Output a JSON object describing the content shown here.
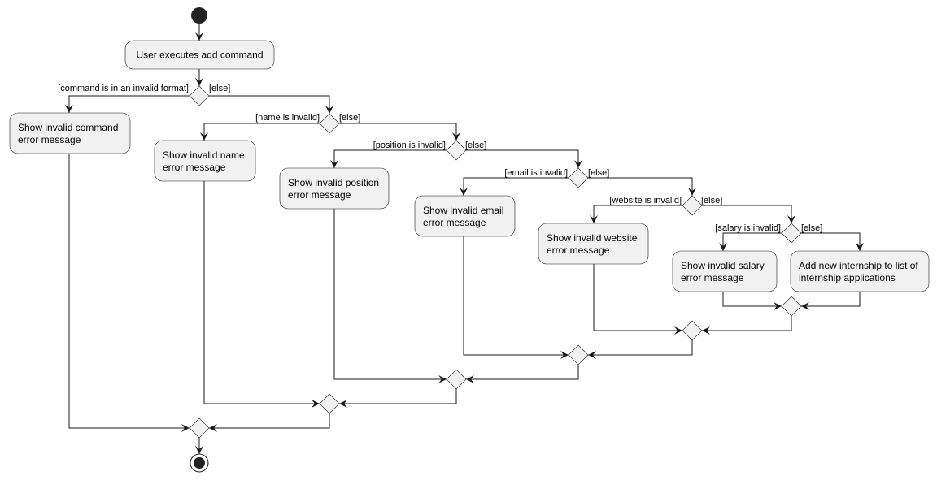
{
  "diagram": {
    "type": "activity",
    "colors": {
      "node_fill": "#f1f1f1",
      "line": "#181818",
      "start_end": "#222222"
    },
    "activities": {
      "start_cmd": [
        "User executes add command"
      ],
      "invalid_command": [
        "Show invalid command",
        "error message"
      ],
      "invalid_name": [
        "Show invalid name",
        "error message"
      ],
      "invalid_position": [
        "Show invalid position",
        "error message"
      ],
      "invalid_email": [
        "Show invalid email",
        "error message"
      ],
      "invalid_website": [
        "Show invalid website",
        "error message"
      ],
      "invalid_salary": [
        "Show invalid salary",
        "error message"
      ],
      "add_internship": [
        "Add new internship to list of",
        "internship applications"
      ]
    },
    "guards": {
      "d1_yes": "[command is in an invalid format]",
      "d1_no": "[else]",
      "d2_yes": "[name is invalid]",
      "d2_no": "[else]",
      "d3_yes": "[position is invalid]",
      "d3_no": "[else]",
      "d4_yes": "[email is invalid]",
      "d4_no": "[else]",
      "d5_yes": "[website is invalid]",
      "d5_no": "[else]",
      "d6_yes": "[salary is invalid]",
      "d6_no": "[else]"
    }
  }
}
